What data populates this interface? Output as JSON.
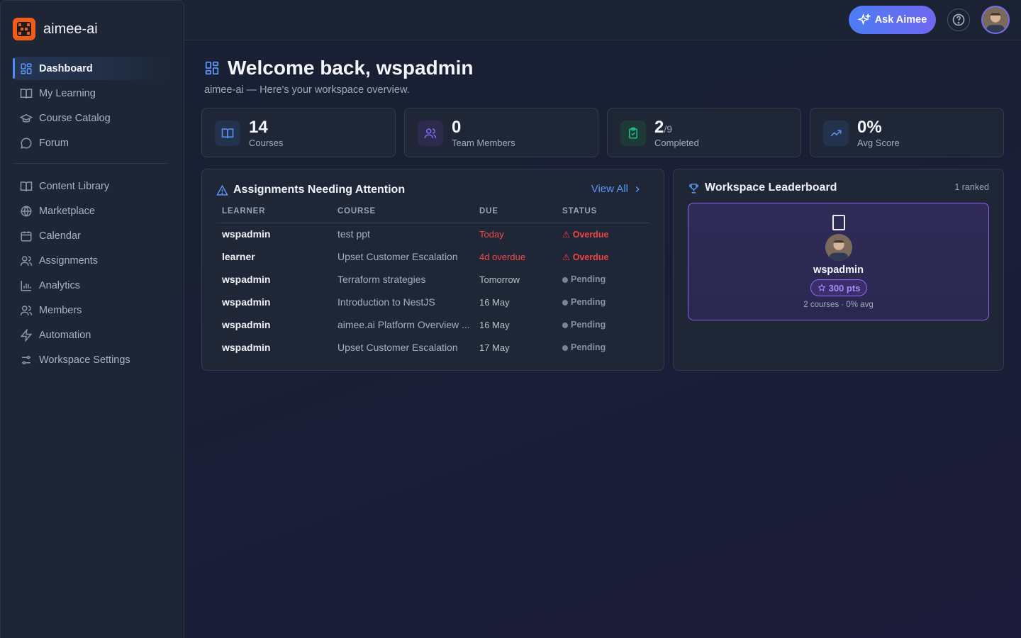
{
  "brand": {
    "name": "aimee-ai"
  },
  "sidebar": {
    "primary": [
      {
        "label": "Dashboard",
        "icon": "dashboard-icon",
        "active": true
      },
      {
        "label": "My Learning",
        "icon": "book-icon"
      },
      {
        "label": "Course Catalog",
        "icon": "graduation-cap-icon"
      },
      {
        "label": "Forum",
        "icon": "chat-bubble-icon"
      }
    ],
    "secondary": [
      {
        "label": "Content Library",
        "icon": "book-icon"
      },
      {
        "label": "Marketplace",
        "icon": "globe-icon"
      },
      {
        "label": "Calendar",
        "icon": "calendar-icon"
      },
      {
        "label": "Assignments",
        "icon": "users-icon"
      },
      {
        "label": "Analytics",
        "icon": "bar-chart-icon"
      },
      {
        "label": "Members",
        "icon": "users-icon"
      },
      {
        "label": "Automation",
        "icon": "lightning-icon"
      },
      {
        "label": "Workspace Settings",
        "icon": "sliders-icon"
      }
    ]
  },
  "topbar": {
    "ask_label": "Ask Aimee"
  },
  "header": {
    "title": "Welcome back, wspadmin",
    "subtitle": "aimee-ai — Here's your workspace overview."
  },
  "stats": {
    "courses": {
      "value": "14",
      "label": "Courses"
    },
    "team": {
      "value": "0",
      "label": "Team Members"
    },
    "completed": {
      "value": "2",
      "total": "/9",
      "label": "Completed"
    },
    "score": {
      "value": "0%",
      "label": "Avg Score"
    }
  },
  "colors": {
    "accent": "#5b95f7",
    "overdue": "#ef4444",
    "leader_border": "#8466f0",
    "courses_icon": "#5b95f7",
    "team_icon": "#8b6cf6",
    "completed_icon": "#22c08a",
    "score_icon": "#5b95f7"
  },
  "assignments": {
    "title": "Assignments Needing Attention",
    "view_all": "View All",
    "headers": [
      "LEARNER",
      "COURSE",
      "DUE",
      "STATUS"
    ],
    "rows": [
      {
        "learner": "wspadmin",
        "course": "test ppt",
        "due": "Today",
        "due_urgent": true,
        "status": "Overdue",
        "status_type": "overdue"
      },
      {
        "learner": "learner",
        "course": "Upset Customer Escalation",
        "due": "4d overdue",
        "due_urgent": true,
        "status": "Overdue",
        "status_type": "overdue"
      },
      {
        "learner": "wspadmin",
        "course": "Terraform strategies",
        "due": "Tomorrow",
        "due_urgent": false,
        "status": "Pending",
        "status_type": "pending"
      },
      {
        "learner": "wspadmin",
        "course": "Introduction to NestJS",
        "due": "16 May",
        "due_urgent": false,
        "status": "Pending",
        "status_type": "pending"
      },
      {
        "learner": "wspadmin",
        "course": "aimee.ai Platform Overview ...",
        "due": "16 May",
        "due_urgent": false,
        "status": "Pending",
        "status_type": "pending"
      },
      {
        "learner": "wspadmin",
        "course": "Upset Customer Escalation",
        "due": "17 May",
        "due_urgent": false,
        "status": "Pending",
        "status_type": "pending"
      }
    ]
  },
  "leaderboard": {
    "title": "Workspace Leaderboard",
    "ranked": "1 ranked",
    "entry": {
      "name": "wspadmin",
      "points": "300 pts",
      "meta": "2 courses · 0% avg"
    }
  }
}
